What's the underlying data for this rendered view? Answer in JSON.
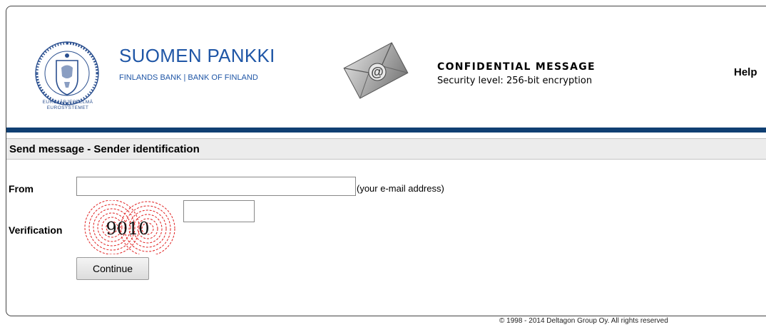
{
  "header": {
    "brand_title": "SUOMEN PANKKI",
    "brand_subtitle": "FINLANDS BANK | BANK OF FINLAND",
    "seal_lines": [
      "EUROJÄRJESTELMÄ",
      "EUROSYSTEMET"
    ],
    "message_title": "CONFIDENTIAL MESSAGE",
    "security_level": "Security level: 256-bit encryption",
    "help_label": "Help"
  },
  "section": {
    "title": "Send message - Sender identification"
  },
  "form": {
    "from_label": "From",
    "from_value": "",
    "from_hint": "(your e-mail address)",
    "verification_label": "Verification",
    "captcha_code": "9010",
    "verification_value": "",
    "continue_label": "Continue"
  },
  "footer": {
    "copyright": "© 1998 - 2014 Deltagon Group Oy. All rights reserved"
  },
  "colors": {
    "brand_blue": "#1f56a6",
    "bar_blue": "#103f72",
    "captcha_red": "#e02020"
  },
  "icons": {
    "seal": "bank-seal-icon",
    "envelope": "envelope-at-icon"
  }
}
